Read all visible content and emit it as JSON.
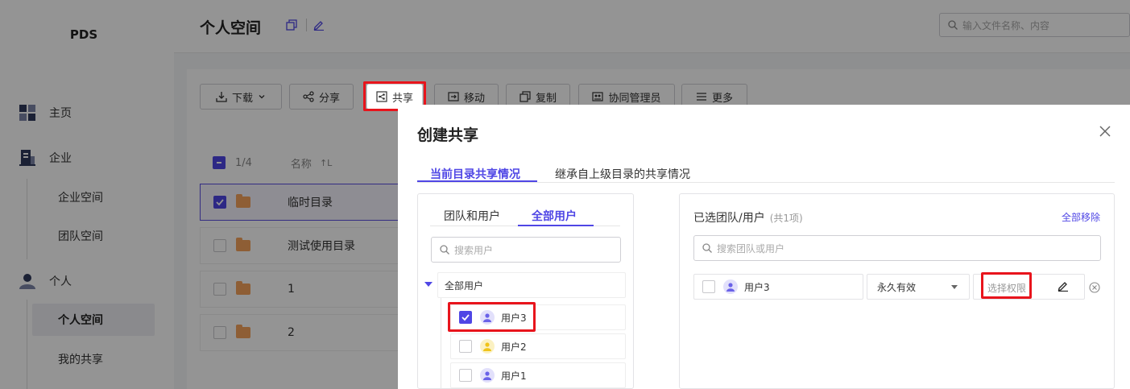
{
  "app": {
    "logo": "PDS"
  },
  "sidebar": {
    "items": [
      {
        "label": "主页",
        "icon": "home-grid-icon"
      },
      {
        "label": "企业",
        "icon": "enterprise-icon"
      },
      {
        "label": "个人",
        "icon": "person-icon"
      }
    ],
    "enterprise_sub": [
      "企业空间",
      "团队空间"
    ],
    "personal_sub": [
      "个人空间",
      "我的共享"
    ],
    "active_sub": "个人空间"
  },
  "header": {
    "title": "个人空间",
    "search_placeholder": "输入文件名称、内容"
  },
  "toolbar": {
    "download": "下载",
    "share": "分享",
    "cooperate_share": "共享",
    "move": "移动",
    "copy": "复制",
    "co_admin": "协同管理员",
    "more": "更多"
  },
  "file_table": {
    "selected_count": "1/4",
    "name_header": "名称",
    "sort_icon": "sort-icon",
    "rows": [
      {
        "name": "临时目录",
        "checked": true
      },
      {
        "name": "测试使用目录",
        "checked": false
      },
      {
        "name": "1",
        "checked": false
      },
      {
        "name": "2",
        "checked": false
      }
    ]
  },
  "dialog": {
    "title": "创建共享",
    "tabs": [
      "当前目录共享情况",
      "继承自上级目录的共享情况"
    ],
    "active_tab": 0,
    "left": {
      "subtabs": [
        "团队和用户",
        "全部用户"
      ],
      "active_subtab": 1,
      "search_placeholder": "搜索用户",
      "tree_root": "全部用户",
      "users": [
        {
          "name": "用户3",
          "checked": true,
          "avatar_color": "#e2e0fb"
        },
        {
          "name": "用户2",
          "checked": false,
          "avatar_color": "#fbf1c2"
        },
        {
          "name": "用户1",
          "checked": false,
          "avatar_color": "#e2e0fb"
        }
      ]
    },
    "right": {
      "title": "已选团队/用户",
      "count": "(共1项)",
      "remove_all": "全部移除",
      "search_placeholder": "搜索团队或用户",
      "selected": [
        {
          "name": "用户3",
          "expiry": "永久有效",
          "permission_placeholder": "选择权限"
        }
      ]
    }
  },
  "colors": {
    "accent": "#4f46e5",
    "highlight": "#e8141c",
    "folder": "#f5a25c"
  }
}
